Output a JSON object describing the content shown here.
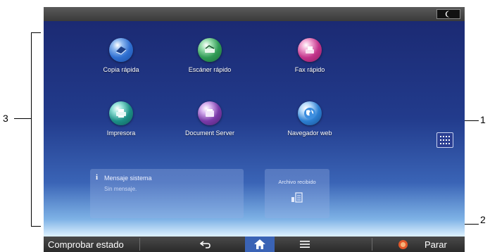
{
  "topbar": {
    "night_icon": "moon-icon"
  },
  "apps": [
    {
      "label": "Copia rápida",
      "icon": "copy-icon",
      "color": "#2f6fd1"
    },
    {
      "label": "Escáner rápido",
      "icon": "scanner-icon",
      "color": "#2f9a55"
    },
    {
      "label": "Fax rápido",
      "icon": "fax-icon",
      "color": "#c2338a"
    },
    {
      "label": "Impresora",
      "icon": "printer-icon",
      "color": "#1c8f86"
    },
    {
      "label": "Document Server",
      "icon": "document-server-icon",
      "color": "#7a3aa8"
    },
    {
      "label": "Navegador web",
      "icon": "globe-icon",
      "color": "#2c7fd2"
    }
  ],
  "app_list_button": {
    "icon": "app-grid-icon"
  },
  "system_message": {
    "title": "Mensaje sistema",
    "body": "Sin mensaje."
  },
  "file_received": {
    "title": "Archivo recibido"
  },
  "bottombar": {
    "status_label": "Comprobar estado",
    "back_icon": "back-arrow-icon",
    "home_icon": "home-icon",
    "menu_icon": "menu-icon",
    "stop_label": "Parar",
    "stop_color": "#e2582a"
  },
  "callouts": {
    "c1": "1",
    "c2": "2",
    "c3": "3"
  }
}
